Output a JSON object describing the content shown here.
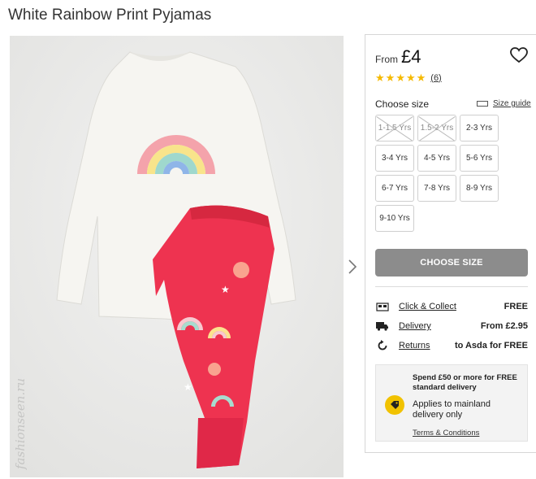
{
  "product": {
    "title": "White Rainbow Print Pyjamas",
    "watermark": "fashionseen.ru"
  },
  "pricing": {
    "from_label": "From",
    "amount": "£4",
    "rating": 5,
    "review_count": "(6)"
  },
  "sizes": {
    "label": "Choose size",
    "guide_label": "Size guide",
    "options": [
      {
        "label": "1-1.5 Yrs",
        "available": false
      },
      {
        "label": "1.5-2 Yrs",
        "available": false
      },
      {
        "label": "2-3 Yrs",
        "available": true
      },
      {
        "label": "3-4 Yrs",
        "available": true
      },
      {
        "label": "4-5 Yrs",
        "available": true
      },
      {
        "label": "5-6 Yrs",
        "available": true
      },
      {
        "label": "6-7 Yrs",
        "available": true
      },
      {
        "label": "7-8 Yrs",
        "available": true
      },
      {
        "label": "8-9 Yrs",
        "available": true
      },
      {
        "label": "9-10 Yrs",
        "available": true
      }
    ]
  },
  "cta": {
    "label": "CHOOSE SIZE"
  },
  "delivery": [
    {
      "icon": "store-icon",
      "label": "Click & Collect",
      "value": "FREE"
    },
    {
      "icon": "truck-icon",
      "label": "Delivery",
      "value": "From £2.95"
    },
    {
      "icon": "return-icon",
      "label": "Returns",
      "value": "to Asda for FREE"
    }
  ],
  "promo": {
    "headline": "Spend £50 or more for FREE standard delivery",
    "body": "Applies to mainland delivery only",
    "link": "Terms & Conditions",
    "icon": "tag-icon"
  },
  "colors": {
    "star": "#f5b900",
    "cta_bg": "#8c8c8c",
    "promo_badge": "#f1c200",
    "pyjama_bottoms": "#ee3350"
  }
}
